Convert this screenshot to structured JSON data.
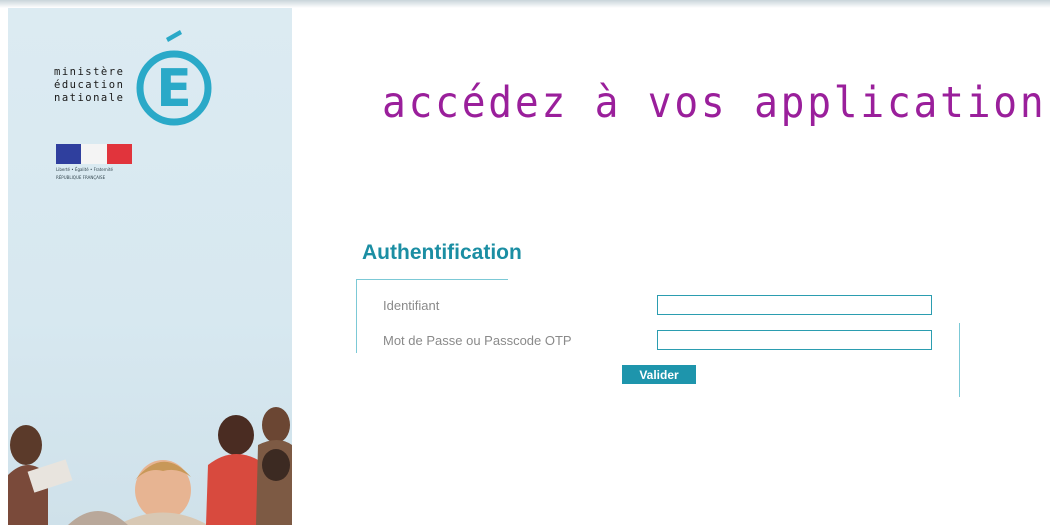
{
  "logo": {
    "lines": [
      "ministère",
      "éducation",
      "nationale"
    ],
    "letter": "É",
    "icon": "ministere-education-nationale-logo"
  },
  "republic": {
    "line1": "Liberté • Égalité • Fraternité",
    "line2": "RÉPUBLIQUE FRANÇAISE",
    "icon": "french-flag-marianne"
  },
  "main": {
    "title": "accédez à vos applications"
  },
  "auth": {
    "title": "Authentification",
    "login_label": "Identifiant",
    "login_value": "",
    "password_label": "Mot de Passe ou Passcode OTP",
    "password_value": "",
    "submit_label": "Valider"
  },
  "colors": {
    "title_purple": "#9a1f9b",
    "accent_teal": "#1e95ac",
    "panel_blue": "#d7e8f0"
  }
}
